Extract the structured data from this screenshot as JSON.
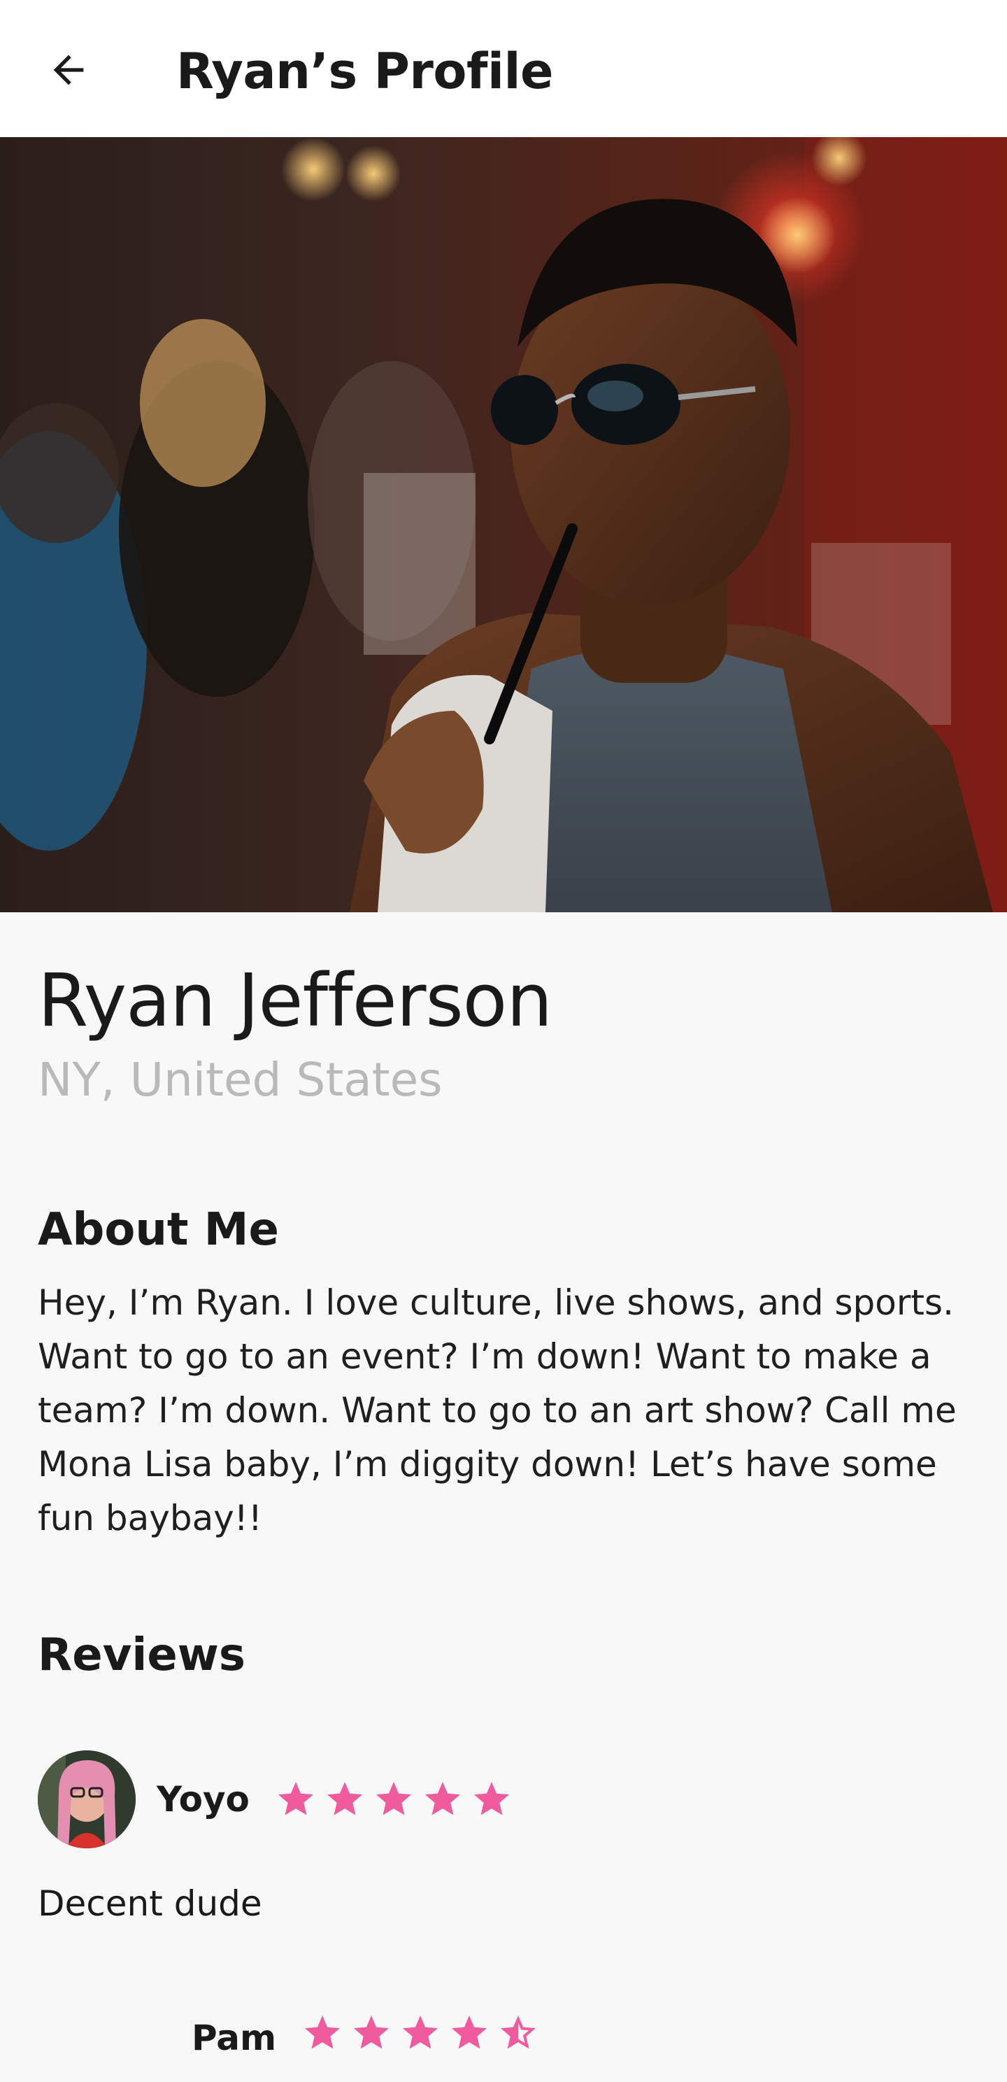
{
  "header": {
    "title": "Ryan’s Profile",
    "back_icon": "arrow-left-icon"
  },
  "profile": {
    "name": "Ryan Jefferson",
    "location": "NY, United States"
  },
  "about": {
    "heading": "About Me",
    "text": "Hey, I’m Ryan. I love culture, live shows, and sports. Want to go to an event? I’m down! Want to make a team? I’m down. Want to go to an art show? Call me Mona Lisa baby, I’m diggity down! Let’s have some fun baybay!!"
  },
  "reviews": {
    "heading": "Reviews",
    "items": [
      {
        "name": "Yoyo",
        "rating": 5,
        "text": "Decent dude"
      },
      {
        "name": "Pam",
        "rating": 4.5,
        "text": ""
      }
    ]
  },
  "colors": {
    "star": "#ef5b9c",
    "background": "#f8f8f8",
    "location_text": "#b9b9b9"
  }
}
